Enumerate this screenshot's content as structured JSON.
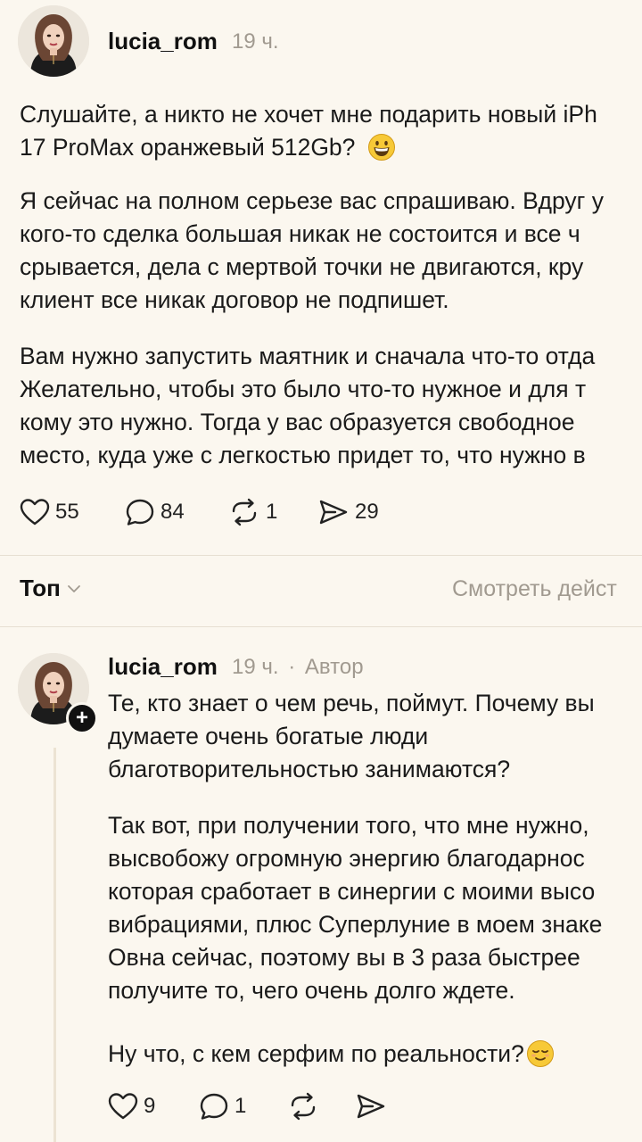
{
  "post": {
    "username": "lucia_rom",
    "time": "19 ч.",
    "paragraphs": [
      [
        "Слушайте, а никто не хочет мне подарить новый iPh",
        "17 ProMax оранжевый 512Gb?"
      ],
      [
        "Я сейчас на полном серьезе вас спрашиваю. Вдруг у",
        "кого-то сделка большая никак не состоится и все ч",
        "срывается, дела с мертвой точки не двигаются, кру",
        "клиент все никак договор не подпишет."
      ],
      [
        "Вам нужно запустить маятник и сначала что-то отда",
        "Желательно, чтобы это было что-то нужное и для т",
        "кому это нужно. Тогда у вас образуется свободное",
        "место, куда уже с легкостью придет то, что нужно в"
      ]
    ],
    "emoji_icon": "grinning-face-emoji",
    "actions": {
      "likes": "55",
      "comments": "84",
      "reposts": "1",
      "shares": "29"
    }
  },
  "comments_bar": {
    "sort_label": "Топ",
    "view_actions_label": "Смотреть дейст"
  },
  "reply": {
    "username": "lucia_rom",
    "time": "19 ч.",
    "separator": "·",
    "author_badge": "Автор",
    "paragraphs": [
      [
        "Те, кто знает о чем речь, поймут. Почему вы",
        "думаете очень богатые люди",
        "благотворительностью занимаются?"
      ],
      [
        "Так вот, при получении того, что мне нужно,",
        "высвобожу огромную энергию благодарнос",
        "которая сработает в синергии с моими высо",
        "вибрациями, плюс Суперлуние в моем знаке",
        "Овна сейчас, поэтому вы в 3 раза быстрее",
        "получите то, чего очень долго ждете."
      ],
      [
        "Ну что, с кем серфим по реальности?"
      ]
    ],
    "emoji_icon": "relieved-face-emoji",
    "actions": {
      "likes": "9",
      "comments": "1"
    }
  },
  "colors": {
    "background": "#fbf7ef",
    "muted_text": "#a19a90",
    "thread_line": "#ece3d3"
  }
}
